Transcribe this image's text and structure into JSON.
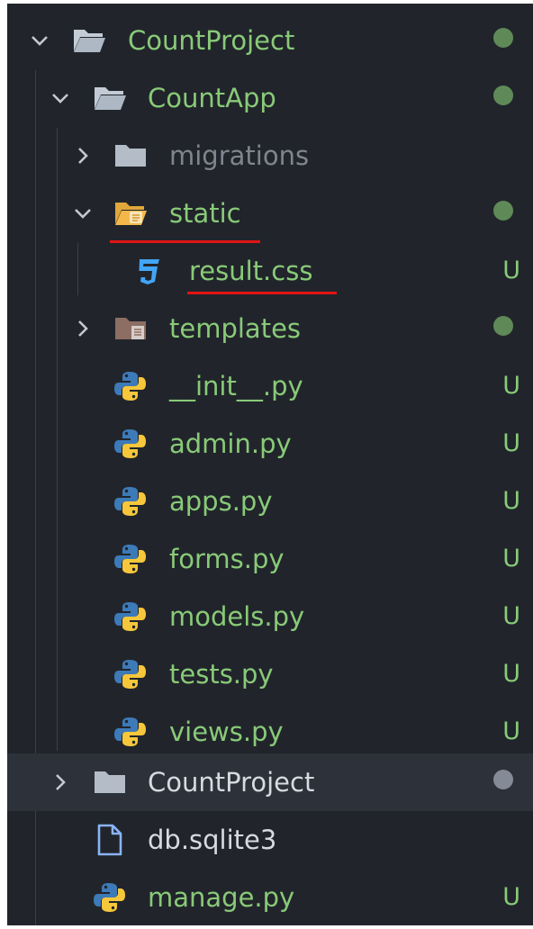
{
  "colors": {
    "untracked_text": "#89ca78",
    "ignored_text": "#7f848e",
    "default_text": "#d7dae0",
    "modified_dot": "#5f8a57",
    "ignored_dot": "#848b96",
    "untracked_badge": "#89ca78",
    "annotation_underline": "#e01414"
  },
  "tree": [
    {
      "label": "CountProject",
      "type": "folder-open",
      "status": "dot"
    },
    {
      "label": "CountApp",
      "type": "folder-open",
      "status": "dot"
    },
    {
      "label": "migrations",
      "type": "folder",
      "status": ""
    },
    {
      "label": "static",
      "type": "folder-static-open",
      "status": "dot"
    },
    {
      "label": "result.css",
      "type": "css-file",
      "status": "U"
    },
    {
      "label": "templates",
      "type": "folder-templates",
      "status": "dot"
    },
    {
      "label": "__init__.py",
      "type": "python-file",
      "status": "U"
    },
    {
      "label": "admin.py",
      "type": "python-file",
      "status": "U"
    },
    {
      "label": "apps.py",
      "type": "python-file",
      "status": "U"
    },
    {
      "label": "forms.py",
      "type": "python-file",
      "status": "U"
    },
    {
      "label": "models.py",
      "type": "python-file",
      "status": "U"
    },
    {
      "label": "tests.py",
      "type": "python-file",
      "status": "U"
    },
    {
      "label": "views.py",
      "type": "python-file",
      "status": "U"
    },
    {
      "label": "CountProject",
      "type": "folder",
      "status": "dot"
    },
    {
      "label": "db.sqlite3",
      "type": "file",
      "status": ""
    },
    {
      "label": "manage.py",
      "type": "python-file",
      "status": "U"
    }
  ]
}
